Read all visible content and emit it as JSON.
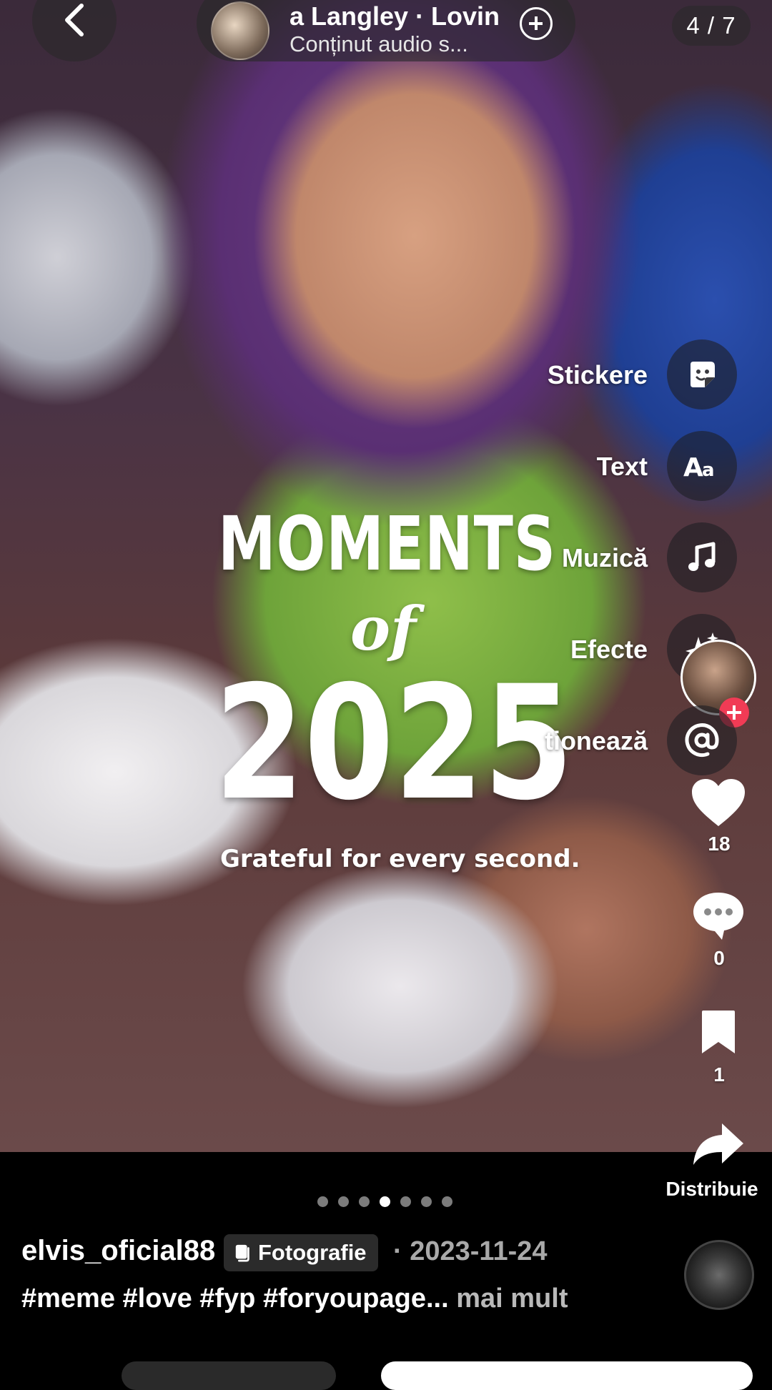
{
  "header": {
    "counter": "4 / 7",
    "sound_title": "a Langley · Lovin",
    "sound_subtitle": "Conținut audio s..."
  },
  "overlay": {
    "line1": "MOMENTS",
    "line2": "of",
    "line3": "2025",
    "tagline": "Grateful for every second."
  },
  "tools": [
    {
      "label": "Stickere",
      "icon": "sticker-icon"
    },
    {
      "label": "Text",
      "icon": "text-aa-icon"
    },
    {
      "label": "Muzică",
      "icon": "music-note-icon"
    },
    {
      "label": "Efecte",
      "icon": "sparkle-icon"
    },
    {
      "label": "tionează",
      "icon": "at-mention-icon"
    }
  ],
  "actions": {
    "likes": "18",
    "comments": "0",
    "saves": "1",
    "share_label": "Distribuie"
  },
  "carousel": {
    "total": 7,
    "active_index": 4
  },
  "post": {
    "username": "elvis_oficial88",
    "type_badge": "Fotografie",
    "separator": "·",
    "date": "2023-11-24",
    "hashtags": "#meme #love #fyp #foryoupage...",
    "more": " mai mult"
  },
  "colors": {
    "follow_accent": "#f13b55",
    "overlay_panel": "#1e1e23"
  }
}
